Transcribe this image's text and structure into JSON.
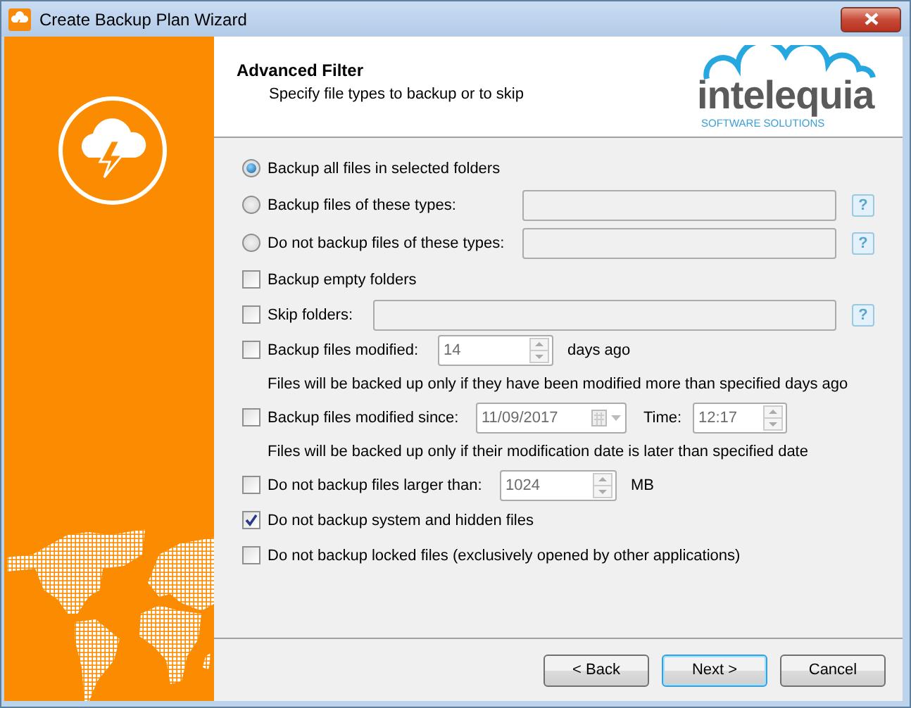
{
  "window": {
    "title": "Create Backup Plan Wizard"
  },
  "header": {
    "title": "Advanced Filter",
    "subtitle": "Specify file types to backup or to skip",
    "logo": {
      "name": "intelequia",
      "tagline": "SOFTWARE SOLUTIONS"
    }
  },
  "options": [
    {
      "kind": "radio",
      "label": "Backup all files in selected folders",
      "selected": true
    },
    {
      "kind": "radio",
      "label": "Backup files of these types:",
      "selected": false,
      "field": {
        "kind": "text",
        "disabled": true,
        "help": "?"
      }
    },
    {
      "kind": "radio",
      "label": "Do not backup files of these types:",
      "selected": false,
      "field": {
        "kind": "text",
        "disabled": true,
        "help": "?"
      }
    },
    {
      "kind": "checkbox",
      "label": "Backup empty folders",
      "checked": false
    },
    {
      "kind": "checkbox",
      "label": "Skip folders:",
      "checked": false,
      "field": {
        "kind": "text",
        "disabled": true,
        "help": "?"
      }
    },
    {
      "kind": "checkbox",
      "label": "Backup files modified:",
      "checked": false,
      "field": {
        "kind": "spin",
        "value": "14",
        "unit": "days ago"
      }
    },
    {
      "kind": "note",
      "label": "Files will be backed up only if they have been modified more than specified days ago"
    },
    {
      "kind": "checkbox",
      "label": "Backup files modified since:",
      "checked": false,
      "field": {
        "kind": "date",
        "value": "11/09/2017",
        "time_label": "Time:",
        "time": "12:17"
      }
    },
    {
      "kind": "note",
      "label": "Files will be backed up only if their modification date is later than specified date"
    },
    {
      "kind": "checkbox",
      "label": "Do not backup files larger than:",
      "checked": false,
      "field": {
        "kind": "spin",
        "value": "1024",
        "unit": "MB"
      }
    },
    {
      "kind": "checkbox",
      "label": "Do not backup system and hidden files",
      "checked": true
    },
    {
      "kind": "checkbox",
      "label": "Do not backup locked files (exclusively opened by other applications)",
      "checked": false
    }
  ],
  "buttons": [
    {
      "label": "< Back",
      "default": false
    },
    {
      "label": "Next >",
      "default": true
    },
    {
      "label": "Cancel",
      "default": false
    }
  ]
}
